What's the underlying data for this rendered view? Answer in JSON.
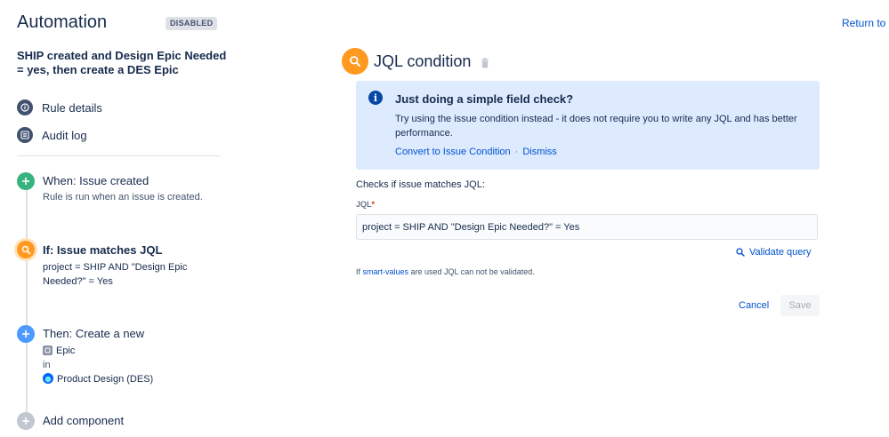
{
  "header": {
    "app_title": "Automation",
    "status_badge": "DISABLED",
    "return_link": "Return to li"
  },
  "rule": {
    "title": "SHIP created and Design Epic Needed = yes, then create a DES Epic"
  },
  "sidebar": {
    "links": [
      {
        "label": "Rule details",
        "icon": "info-circle-icon"
      },
      {
        "label": "Audit log",
        "icon": "list-icon"
      }
    ]
  },
  "components": {
    "trigger": {
      "title": "When: Issue created",
      "subtitle": "Rule is run when an issue is created.",
      "icon": "plus-icon",
      "color": "#36b37e"
    },
    "condition": {
      "title": "If: Issue matches JQL",
      "detail": "project = SHIP AND \"Design Epic Needed?\" = Yes",
      "icon": "search-icon",
      "color": "#ff991f"
    },
    "action": {
      "title": "Then: Create a new",
      "issue_type": "Epic",
      "in_label": "in",
      "project": "Product Design (DES)",
      "icon": "plus-icon",
      "color": "#4c9aff"
    },
    "add": {
      "label": "Add component",
      "icon": "plus-icon",
      "color": "#c1c7d0"
    }
  },
  "panel": {
    "title": "JQL condition",
    "info": {
      "title": "Just doing a simple field check?",
      "body": "Try using the issue condition instead - it does not require you to write any JQL and has better performance.",
      "convert_link": "Convert to Issue Condition",
      "separator": "·",
      "dismiss_link": "Dismiss"
    },
    "checks_label": "Checks if issue matches JQL:",
    "jql_label": "JQL",
    "required_marker": "*",
    "jql_value": "project = SHIP AND \"Design Epic Needed?\" = Yes",
    "validate_label": "Validate query",
    "note_prefix": "If ",
    "note_link": "smart-values",
    "note_suffix": " are used JQL can not be validated.",
    "cancel_label": "Cancel",
    "save_label": "Save"
  },
  "colors": {
    "link": "#0052cc",
    "info_bg": "#deebff",
    "text": "#172b4d"
  }
}
